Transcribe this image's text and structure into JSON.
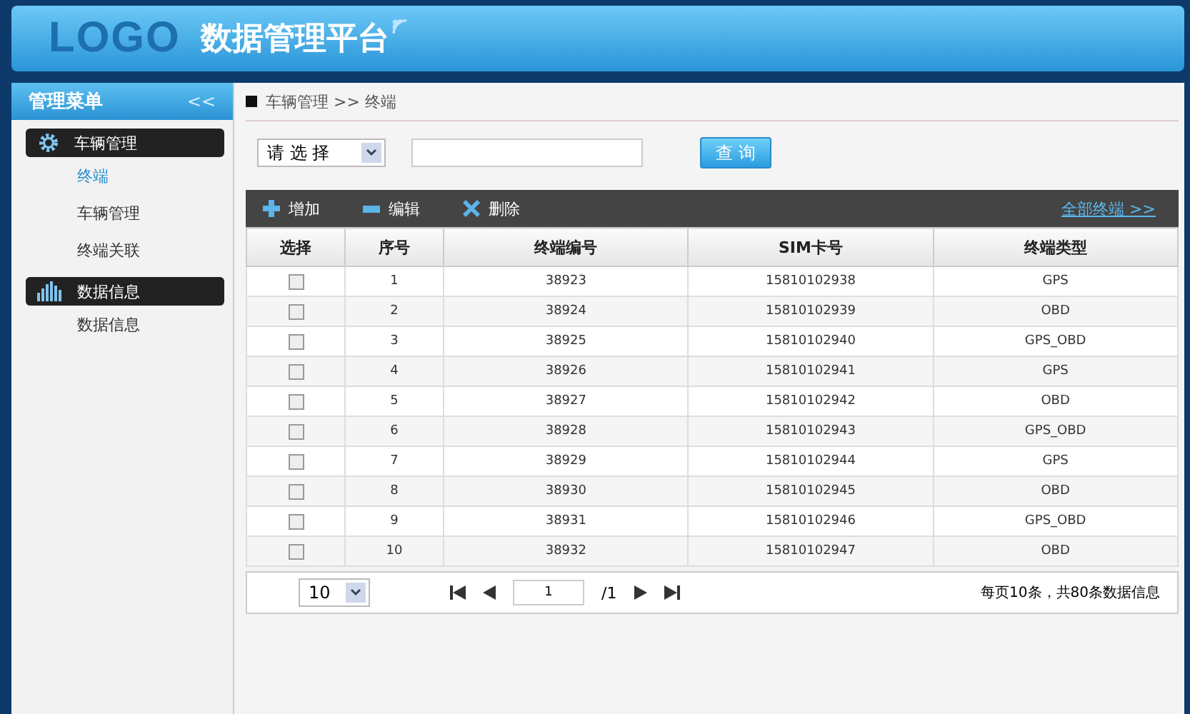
{
  "header": {
    "logo": "LOGO",
    "title": "数据管理平台"
  },
  "sidebar": {
    "title": "管理菜单",
    "collapse": "<<",
    "groups": [
      {
        "label": "车辆管理",
        "kind": "gear",
        "items": [
          {
            "label": "终端",
            "selected": true
          },
          {
            "label": "车辆管理",
            "selected": false
          },
          {
            "label": "终端关联",
            "selected": false
          }
        ]
      },
      {
        "label": "数据信息",
        "kind": "bars",
        "items": [
          {
            "label": "数据信息",
            "selected": false
          }
        ]
      }
    ]
  },
  "breadcrumb": "车辆管理 >> 终端",
  "search": {
    "select": "请 选 择",
    "button": "查 询"
  },
  "toolbar": {
    "actions": [
      {
        "label": "增加",
        "kind": "add"
      },
      {
        "label": "编辑",
        "kind": "edit"
      },
      {
        "label": "删除",
        "kind": "delete"
      }
    ],
    "link": "全部终端 >>"
  },
  "table": {
    "columns": [
      "选择",
      "序号",
      "终端编号",
      "SIM卡号",
      "终端类型"
    ],
    "rows": [
      {
        "checked": false,
        "number": "1",
        "terminal_id": "38923",
        "sim": "15810102938",
        "type": "GPS"
      },
      {
        "checked": false,
        "number": "2",
        "terminal_id": "38924",
        "sim": "15810102939",
        "type": "OBD"
      },
      {
        "checked": false,
        "number": "3",
        "terminal_id": "38925",
        "sim": "15810102940",
        "type": "GPS_OBD"
      },
      {
        "checked": false,
        "number": "4",
        "terminal_id": "38926",
        "sim": "15810102941",
        "type": "GPS"
      },
      {
        "checked": false,
        "number": "5",
        "terminal_id": "38927",
        "sim": "15810102942",
        "type": "OBD"
      },
      {
        "checked": false,
        "number": "6",
        "terminal_id": "38928",
        "sim": "15810102943",
        "type": "GPS_OBD"
      },
      {
        "checked": false,
        "number": "7",
        "terminal_id": "38929",
        "sim": "15810102944",
        "type": "GPS"
      },
      {
        "checked": false,
        "number": "8",
        "terminal_id": "38930",
        "sim": "15810102945",
        "type": "OBD"
      },
      {
        "checked": false,
        "number": "9",
        "terminal_id": "38931",
        "sim": "15810102946",
        "type": "GPS_OBD"
      },
      {
        "checked": false,
        "number": "10",
        "terminal_id": "38932",
        "sim": "15810102947",
        "type": "OBD"
      }
    ]
  },
  "pagination": {
    "page_size": "10",
    "page": "1",
    "total_pages": "/1",
    "summary": "每页10条，共80条数据信息"
  }
}
